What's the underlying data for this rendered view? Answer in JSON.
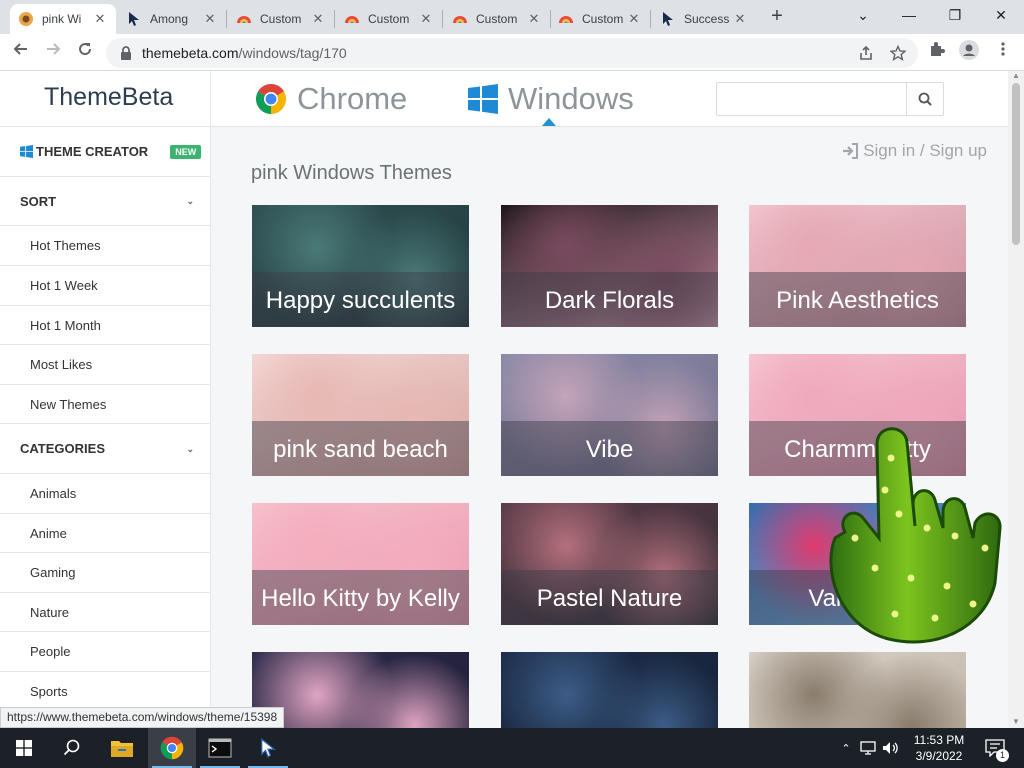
{
  "browser": {
    "tabs": [
      {
        "title": "pink Wi",
        "icon": "themebeta-favicon-icon",
        "active": true
      },
      {
        "title": "Among",
        "icon": "cursor-arrow-favicon-icon",
        "active": false
      },
      {
        "title": "Custom",
        "icon": "custom-cursor-favicon-icon",
        "active": false
      },
      {
        "title": "Custom",
        "icon": "custom-cursor-favicon-icon",
        "active": false
      },
      {
        "title": "Custom",
        "icon": "custom-cursor-favicon-icon",
        "active": false
      },
      {
        "title": "Custom",
        "icon": "custom-cursor-favicon-icon",
        "active": false
      },
      {
        "title": "Success",
        "icon": "cursor-arrow-favicon-icon",
        "active": false
      }
    ],
    "tab_close_glyph": "✕",
    "new_tab_glyph": "+",
    "window_controls": {
      "tabsearch": "⌄",
      "minimize": "—",
      "restore": "❐",
      "close": "✕"
    },
    "url_host": "themebeta.com",
    "url_path": "/windows/tag/170"
  },
  "site": {
    "logo": "ThemeBeta",
    "nav": [
      {
        "label": "Chrome",
        "icon": "chrome-logo-icon"
      },
      {
        "label": "Windows",
        "icon": "windows-logo-icon"
      }
    ],
    "search_placeholder": "",
    "signin_label": "Sign in / Sign up",
    "sidebar": {
      "theme_creator": "THEME CREATOR",
      "new_badge": "NEW",
      "sort_heading": "SORT",
      "sort_items": [
        "Hot Themes",
        "Hot 1 Week",
        "Hot 1 Month",
        "Most Likes",
        "New Themes"
      ],
      "categories_heading": "CATEGORIES",
      "category_items": [
        "Animals",
        "Anime",
        "Gaming",
        "Nature",
        "People",
        "Sports"
      ]
    },
    "page_heading": "pink Windows Themes",
    "themes": [
      {
        "title": "Happy succulents",
        "colors": [
          "#2f4f52",
          "#4a7a78",
          "#1f3436"
        ]
      },
      {
        "title": "Dark Florals",
        "colors": [
          "#1a1416",
          "#7a4a5e",
          "#c690a6"
        ]
      },
      {
        "title": "Pink Aesthetics",
        "colors": [
          "#f2c7cf",
          "#e6a8b4",
          "#c98c99"
        ]
      },
      {
        "title": "pink sand beach",
        "colors": [
          "#f4d9d6",
          "#e8b8b4",
          "#d4a19c"
        ]
      },
      {
        "title": "Vibe",
        "colors": [
          "#8b8aa8",
          "#c4a4b8",
          "#6b6a88"
        ]
      },
      {
        "title": "Charmmykitty",
        "colors": [
          "#f7c6d3",
          "#f0a9bd",
          "#e38fa8"
        ]
      },
      {
        "title": "Hello Kitty by Kelly",
        "colors": [
          "#f7c1cd",
          "#f4aebe",
          "#e895ab"
        ]
      },
      {
        "title": "Pastel Nature",
        "colors": [
          "#5a3b48",
          "#b4707c",
          "#2d2b33"
        ]
      },
      {
        "title": "Valentine",
        "colors": [
          "#2f6fb0",
          "#e03a6e",
          "#79a9d9"
        ]
      },
      {
        "title": "",
        "colors": [
          "#2a2a4a",
          "#e0a5c2",
          "#1e1a30"
        ]
      },
      {
        "title": "",
        "colors": [
          "#1d2d4a",
          "#3c5c86",
          "#121c2e"
        ]
      },
      {
        "title": "",
        "colors": [
          "#d9d2c8",
          "#8a7d6e",
          "#b8ad9e"
        ]
      }
    ]
  },
  "status_url": "https://www.themebeta.com/windows/theme/15398",
  "taskbar": {
    "apps": [
      "windows-start-icon",
      "search-icon",
      "file-explorer-icon",
      "chrome-icon",
      "terminal-icon",
      "cursor-app-icon"
    ],
    "time": "11:53 PM",
    "date": "3/9/2022",
    "notification_count": "1"
  }
}
